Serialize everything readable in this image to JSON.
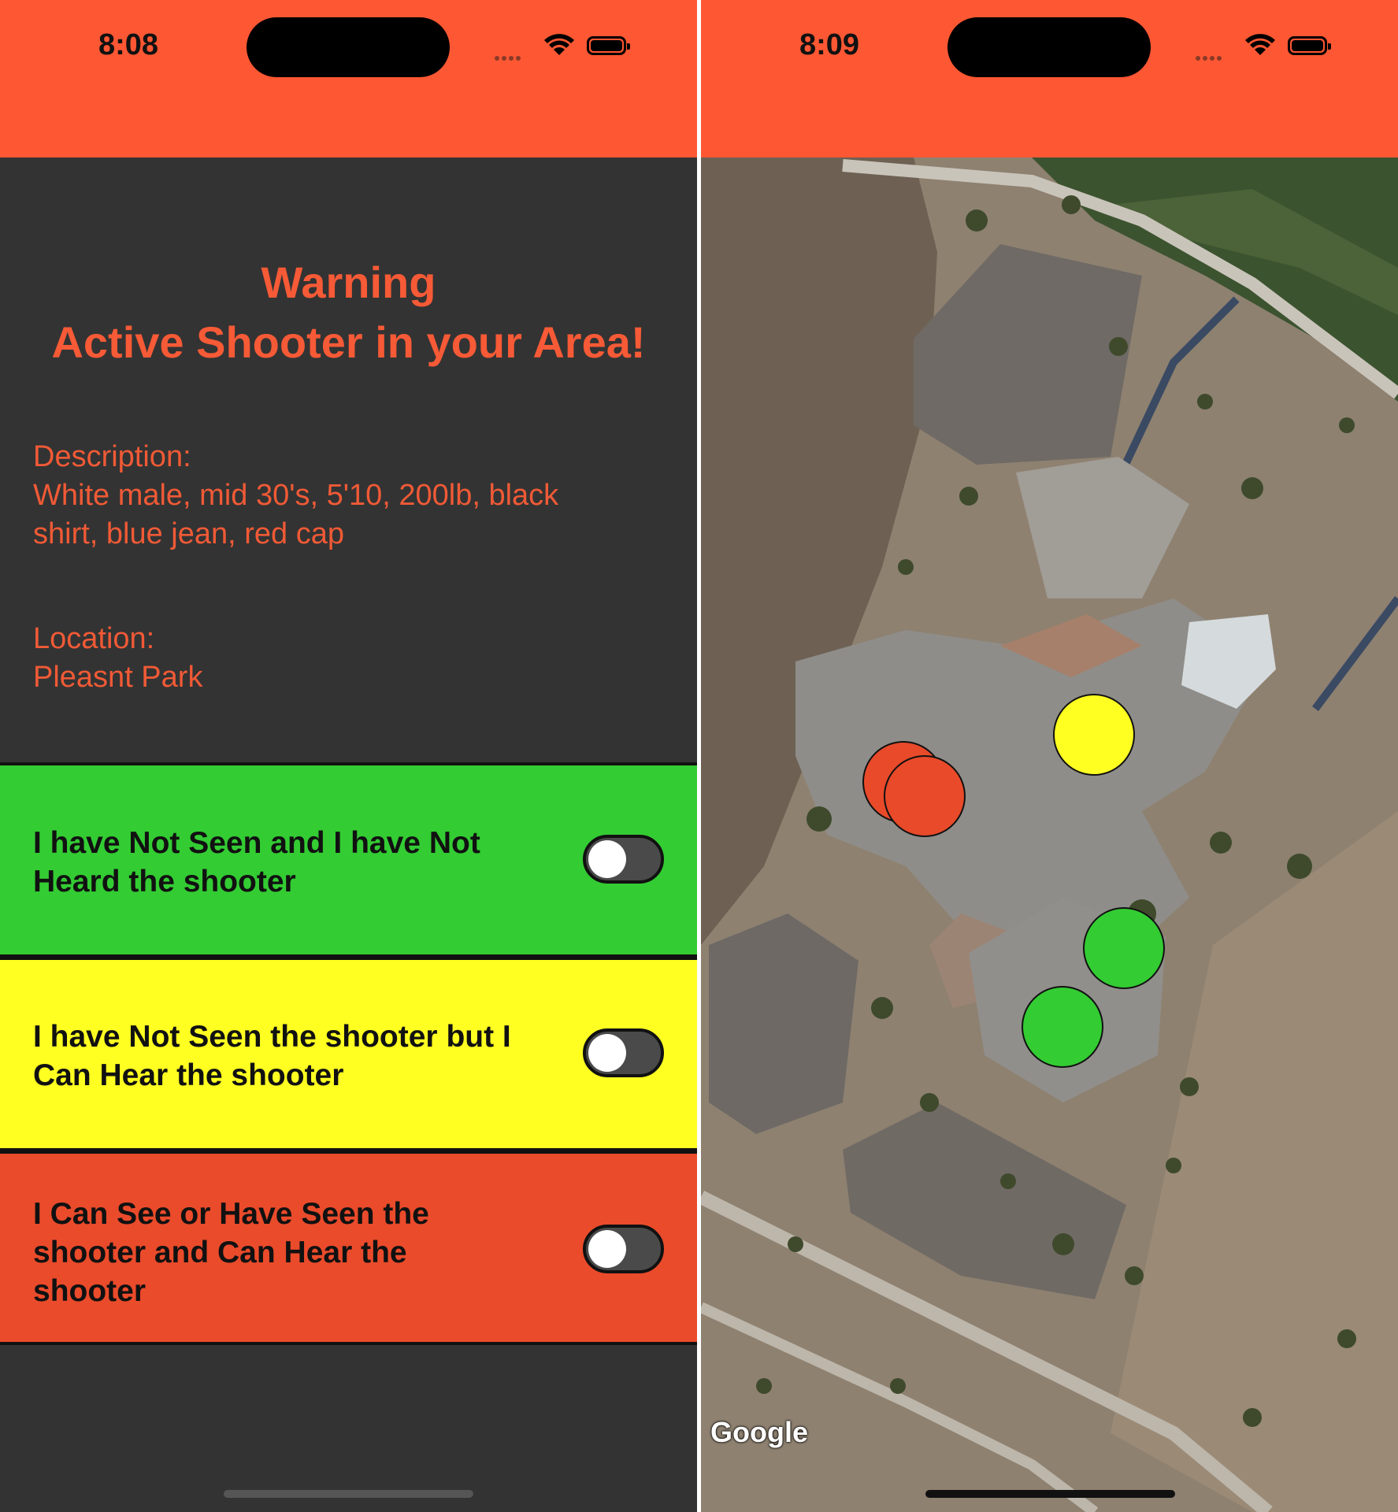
{
  "left_screen": {
    "status_bar": {
      "time": "8:08"
    },
    "alert": {
      "title": "Warning",
      "subtitle": "Active Shooter in your Area!"
    },
    "description": {
      "label": "Description:",
      "line1": "White male, mid 30's, 5'10, 200lb, black",
      "line2": "shirt, blue jean, red cap"
    },
    "location": {
      "label": "Location:",
      "value": "Pleasnt Park"
    },
    "options": [
      {
        "line1": "I have Not Seen and I have Not",
        "line2": "Heard the shooter",
        "line3": "",
        "color": "#33cc33",
        "toggled": false
      },
      {
        "line1": "I have Not Seen the shooter but I",
        "line2": "Can Hear the shooter",
        "line3": "",
        "color": "#ffff22",
        "toggled": false
      },
      {
        "line1": "I Can See or Have Seen the",
        "line2": "shooter and Can Hear the",
        "line3": "shooter",
        "color": "#ea4b2b",
        "toggled": false
      }
    ]
  },
  "right_screen": {
    "status_bar": {
      "time": "8:09"
    },
    "map": {
      "attribution": "Google",
      "markers": [
        {
          "status": "red",
          "color": "#e84a2a"
        },
        {
          "status": "red",
          "color": "#e84a2a"
        },
        {
          "status": "yellow",
          "color": "#ffff22"
        },
        {
          "status": "green",
          "color": "#33cc33"
        },
        {
          "status": "green",
          "color": "#33cc33"
        }
      ]
    }
  },
  "colors": {
    "accent": "#fe5733",
    "background": "#333333",
    "text_alert": "#f65a36"
  }
}
